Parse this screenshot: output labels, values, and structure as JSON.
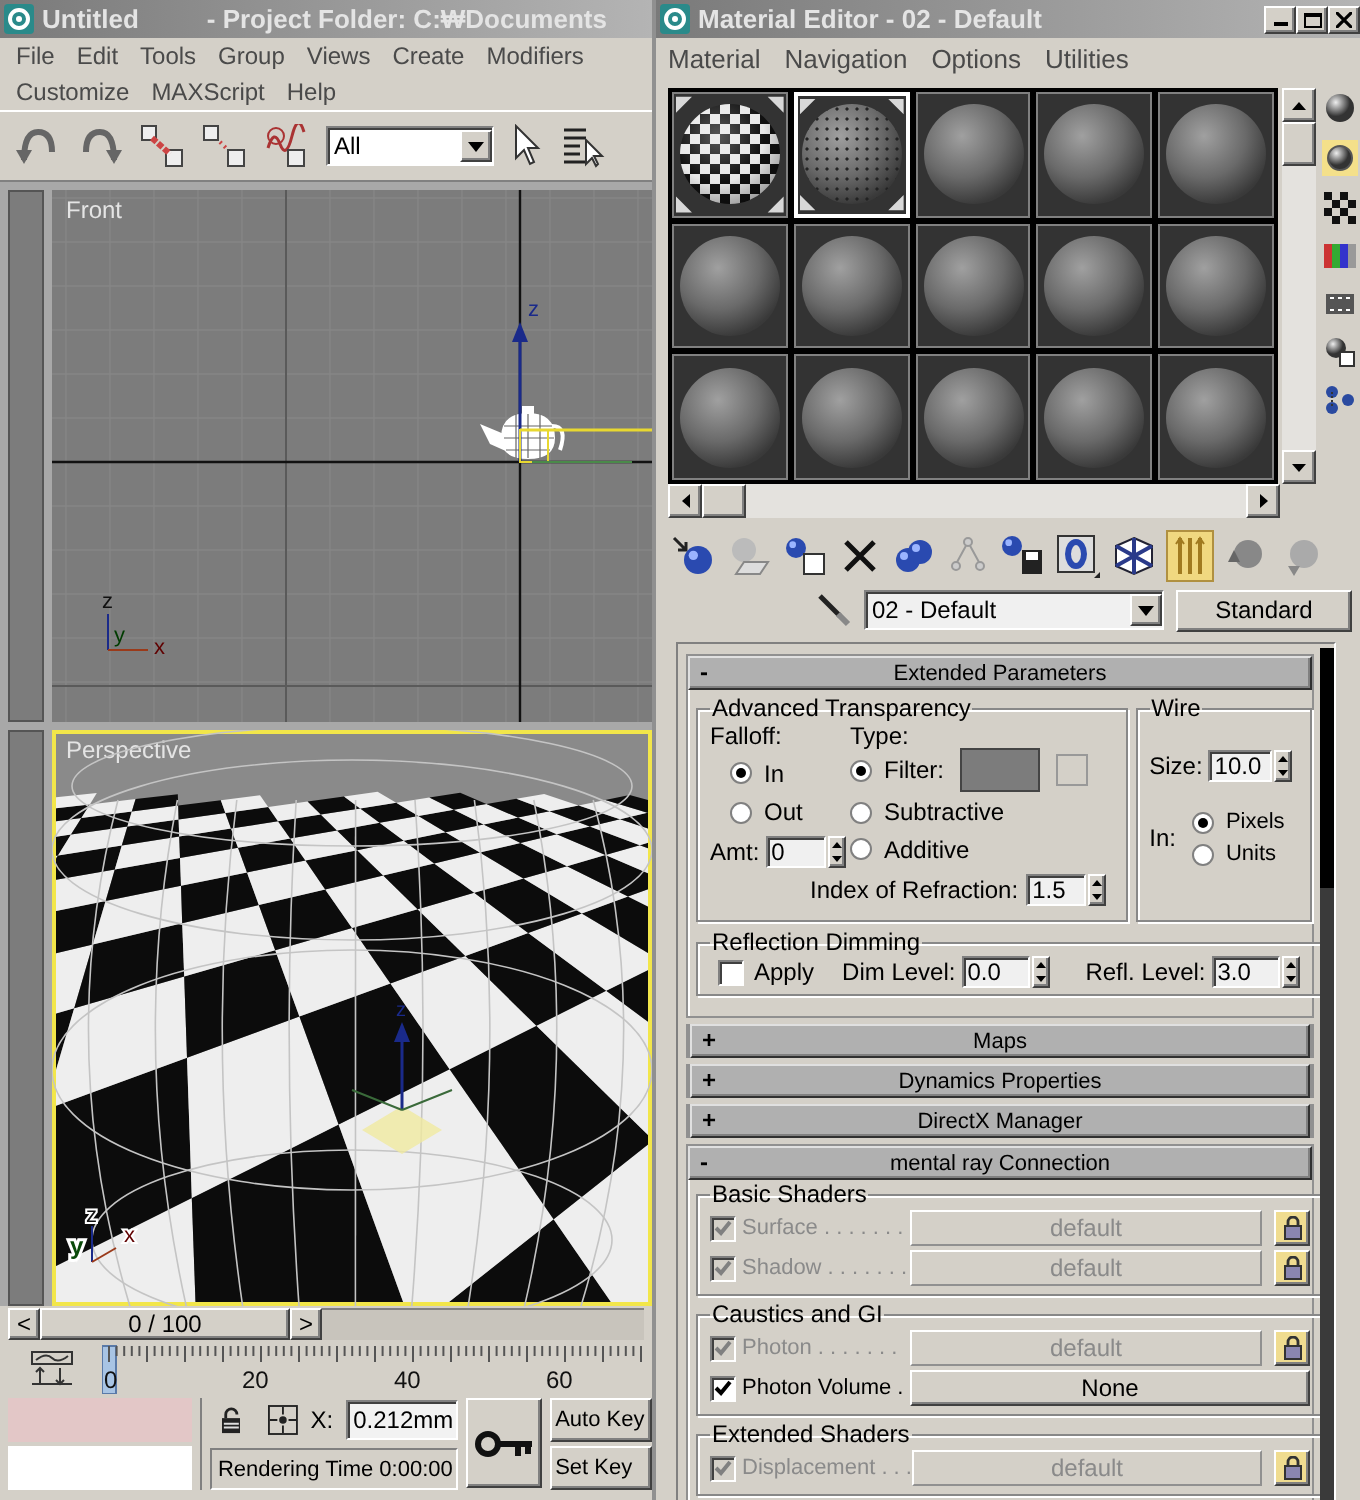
{
  "main_window": {
    "title": "Untitled",
    "project_folder": "- Project Folder: C:₩Documents",
    "menu_rows": [
      {
        "items": [
          "File",
          "Edit",
          "Tools",
          "Group",
          "Views",
          "Create",
          "Modifiers"
        ]
      },
      {
        "items": [
          "Customize",
          "MAXScript",
          "Help"
        ]
      }
    ],
    "selection_filter": "All",
    "viewports": [
      {
        "kind": "front",
        "label": "Front",
        "active": false,
        "gizmo_label": "z",
        "tripod_labels": [
          "z",
          "y",
          "x"
        ]
      },
      {
        "kind": "perspective",
        "label": "Perspective",
        "active": true,
        "gizmo_label": "z",
        "tripod_labels": [
          "z",
          "y",
          "x"
        ]
      }
    ],
    "time_slider": {
      "prev": "<",
      "position": "0 / 100",
      "next": ">"
    },
    "track_bar": {
      "ticks": [
        "0",
        "20",
        "40",
        "60"
      ]
    },
    "coordinate": {
      "label": "X:",
      "value": "0.212mm"
    },
    "auto_key": "Auto Key",
    "set_key": "Set Key",
    "prompt": "Rendering Time  0:00:00"
  },
  "material_editor": {
    "title": "Material Editor - 02 - Default",
    "menu": [
      "Material",
      "Navigation",
      "Options",
      "Utilities"
    ],
    "slots": [
      {
        "kind": "checker",
        "selected": false,
        "in_scene": true
      },
      {
        "kind": "speckled",
        "selected": true,
        "in_scene": true
      },
      {
        "kind": "plain",
        "selected": false,
        "in_scene": false
      },
      {
        "kind": "plain",
        "selected": false,
        "in_scene": false
      },
      {
        "kind": "plain",
        "selected": false,
        "in_scene": false
      },
      {
        "kind": "plain",
        "selected": false,
        "in_scene": false
      },
      {
        "kind": "plain",
        "selected": false,
        "in_scene": false
      },
      {
        "kind": "plain",
        "selected": false,
        "in_scene": false
      },
      {
        "kind": "plain",
        "selected": false,
        "in_scene": false
      },
      {
        "kind": "plain",
        "selected": false,
        "in_scene": false
      },
      {
        "kind": "plain",
        "selected": false,
        "in_scene": false
      },
      {
        "kind": "plain",
        "selected": false,
        "in_scene": false
      },
      {
        "kind": "plain",
        "selected": false,
        "in_scene": false
      },
      {
        "kind": "plain",
        "selected": false,
        "in_scene": false
      },
      {
        "kind": "plain",
        "selected": false,
        "in_scene": false
      }
    ],
    "material_name": "02 - Default",
    "material_type": "Standard",
    "rollouts": [
      {
        "kind": "extended",
        "sign": "-",
        "title": "Extended Parameters",
        "expanded": true,
        "advanced_transparency": {
          "title": "Advanced Transparency",
          "falloff_label": "Falloff:",
          "falloff": [
            {
              "label": "In",
              "selected": true
            },
            {
              "label": "Out",
              "selected": false
            }
          ],
          "type_label": "Type:",
          "types": [
            {
              "label": "Filter:",
              "selected": true
            },
            {
              "label": "Subtractive",
              "selected": false
            },
            {
              "label": "Additive",
              "selected": false
            }
          ],
          "amount_label": "Amt:",
          "amount": "0",
          "ior_label": "Index of Refraction:",
          "ior": "1.5"
        },
        "wire": {
          "title": "Wire",
          "size_label": "Size:",
          "size": "10.0",
          "in_label": "In:",
          "units": [
            {
              "label": "Pixels",
              "selected": true
            },
            {
              "label": "Units",
              "selected": false
            }
          ]
        },
        "reflection_dimming": {
          "title": "Reflection Dimming",
          "apply_label": "Apply",
          "apply": false,
          "dim_label": "Dim Level:",
          "dim_level": "0.0",
          "refl_label": "Refl. Level:",
          "refl_level": "3.0"
        }
      },
      {
        "kind": "collapsed",
        "sign": "+",
        "title": "Maps",
        "expanded": false
      },
      {
        "kind": "collapsed",
        "sign": "+",
        "title": "Dynamics Properties",
        "expanded": false
      },
      {
        "kind": "collapsed",
        "sign": "+",
        "title": "DirectX Manager",
        "expanded": false
      },
      {
        "kind": "mental_ray",
        "sign": "-",
        "title": "mental ray Connection",
        "expanded": true,
        "groups": [
          {
            "title": "Basic Shaders",
            "rows": [
              {
                "label": "Surface . . . . . . .",
                "checked": true,
                "disabled": true,
                "value": "default",
                "lock": true
              },
              {
                "label": "Shadow . . . . . . .",
                "checked": true,
                "disabled": true,
                "value": "default",
                "lock": true
              }
            ]
          },
          {
            "title": "Caustics and GI",
            "rows": [
              {
                "label": "Photon . . . . . . .",
                "checked": true,
                "disabled": true,
                "value": "default",
                "lock": true
              },
              {
                "label": "Photon Volume .",
                "checked": true,
                "disabled": false,
                "value": "None",
                "lock": false
              }
            ]
          },
          {
            "title": "Extended Shaders",
            "rows": [
              {
                "label": "Displacement . . .",
                "checked": true,
                "disabled": true,
                "value": "default",
                "lock": true
              }
            ]
          }
        ]
      }
    ]
  }
}
